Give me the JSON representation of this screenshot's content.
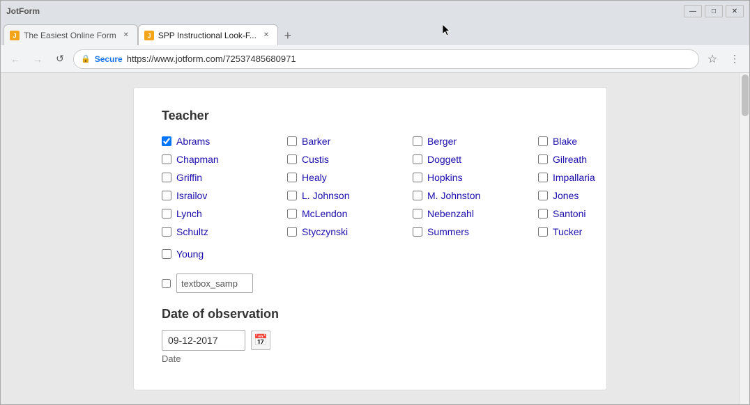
{
  "browser": {
    "brand": "JotForm",
    "title_bar": {
      "minimize": "—",
      "maximize": "□",
      "close": "✕"
    },
    "tabs": [
      {
        "id": "tab1",
        "label": "The Easiest Online Form",
        "active": false,
        "favicon_color": "#f4a418"
      },
      {
        "id": "tab2",
        "label": "SPP Instructional Look-F...",
        "active": true,
        "favicon_color": "#f4a418"
      }
    ],
    "tab_new_label": "+",
    "nav": {
      "back": "←",
      "forward": "→",
      "reload": "↺"
    },
    "address": {
      "secure_label": "Secure",
      "url": "https://www.jotform.com/72537485680971"
    },
    "star": "☆",
    "menu": "⋮"
  },
  "form": {
    "teacher_section": {
      "title": "Teacher",
      "checkboxes": [
        {
          "id": "cb_abrams",
          "label": "Abrams",
          "checked": true
        },
        {
          "id": "cb_barker",
          "label": "Barker",
          "checked": false
        },
        {
          "id": "cb_berger",
          "label": "Berger",
          "checked": false
        },
        {
          "id": "cb_blake",
          "label": "Blake",
          "checked": false
        },
        {
          "id": "cb_chapman",
          "label": "Chapman",
          "checked": false
        },
        {
          "id": "cb_custis",
          "label": "Custis",
          "checked": false
        },
        {
          "id": "cb_doggett",
          "label": "Doggett",
          "checked": false
        },
        {
          "id": "cb_gilreath",
          "label": "Gilreath",
          "checked": false
        },
        {
          "id": "cb_griffin",
          "label": "Griffin",
          "checked": false
        },
        {
          "id": "cb_healy",
          "label": "Healy",
          "checked": false
        },
        {
          "id": "cb_hopkins",
          "label": "Hopkins",
          "checked": false
        },
        {
          "id": "cb_impallaria",
          "label": "Impallaria",
          "checked": false
        },
        {
          "id": "cb_israilov",
          "label": "Israilov",
          "checked": false
        },
        {
          "id": "cb_ljohnson",
          "label": "L. Johnson",
          "checked": false
        },
        {
          "id": "cb_mjohnston",
          "label": "M. Johnston",
          "checked": false
        },
        {
          "id": "cb_jones",
          "label": "Jones",
          "checked": false
        },
        {
          "id": "cb_lynch",
          "label": "Lynch",
          "checked": false
        },
        {
          "id": "cb_mclendon",
          "label": "McLendon",
          "checked": false
        },
        {
          "id": "cb_nebenzahl",
          "label": "Nebenzahl",
          "checked": false
        },
        {
          "id": "cb_santoni",
          "label": "Santoni",
          "checked": false
        },
        {
          "id": "cb_schultz",
          "label": "Schultz",
          "checked": false
        },
        {
          "id": "cb_styczynski",
          "label": "Styczynski",
          "checked": false
        },
        {
          "id": "cb_summers",
          "label": "Summers",
          "checked": false
        },
        {
          "id": "cb_tucker",
          "label": "Tucker",
          "checked": false
        },
        {
          "id": "cb_young",
          "label": "Young",
          "checked": false
        }
      ],
      "other_checkbox_id": "cb_other",
      "other_checked": false,
      "other_placeholder": "textbox_samp"
    },
    "date_section": {
      "title": "Date of observation",
      "date_value": "09-12-2017",
      "date_label": "Date",
      "calendar_icon": "📅"
    }
  }
}
